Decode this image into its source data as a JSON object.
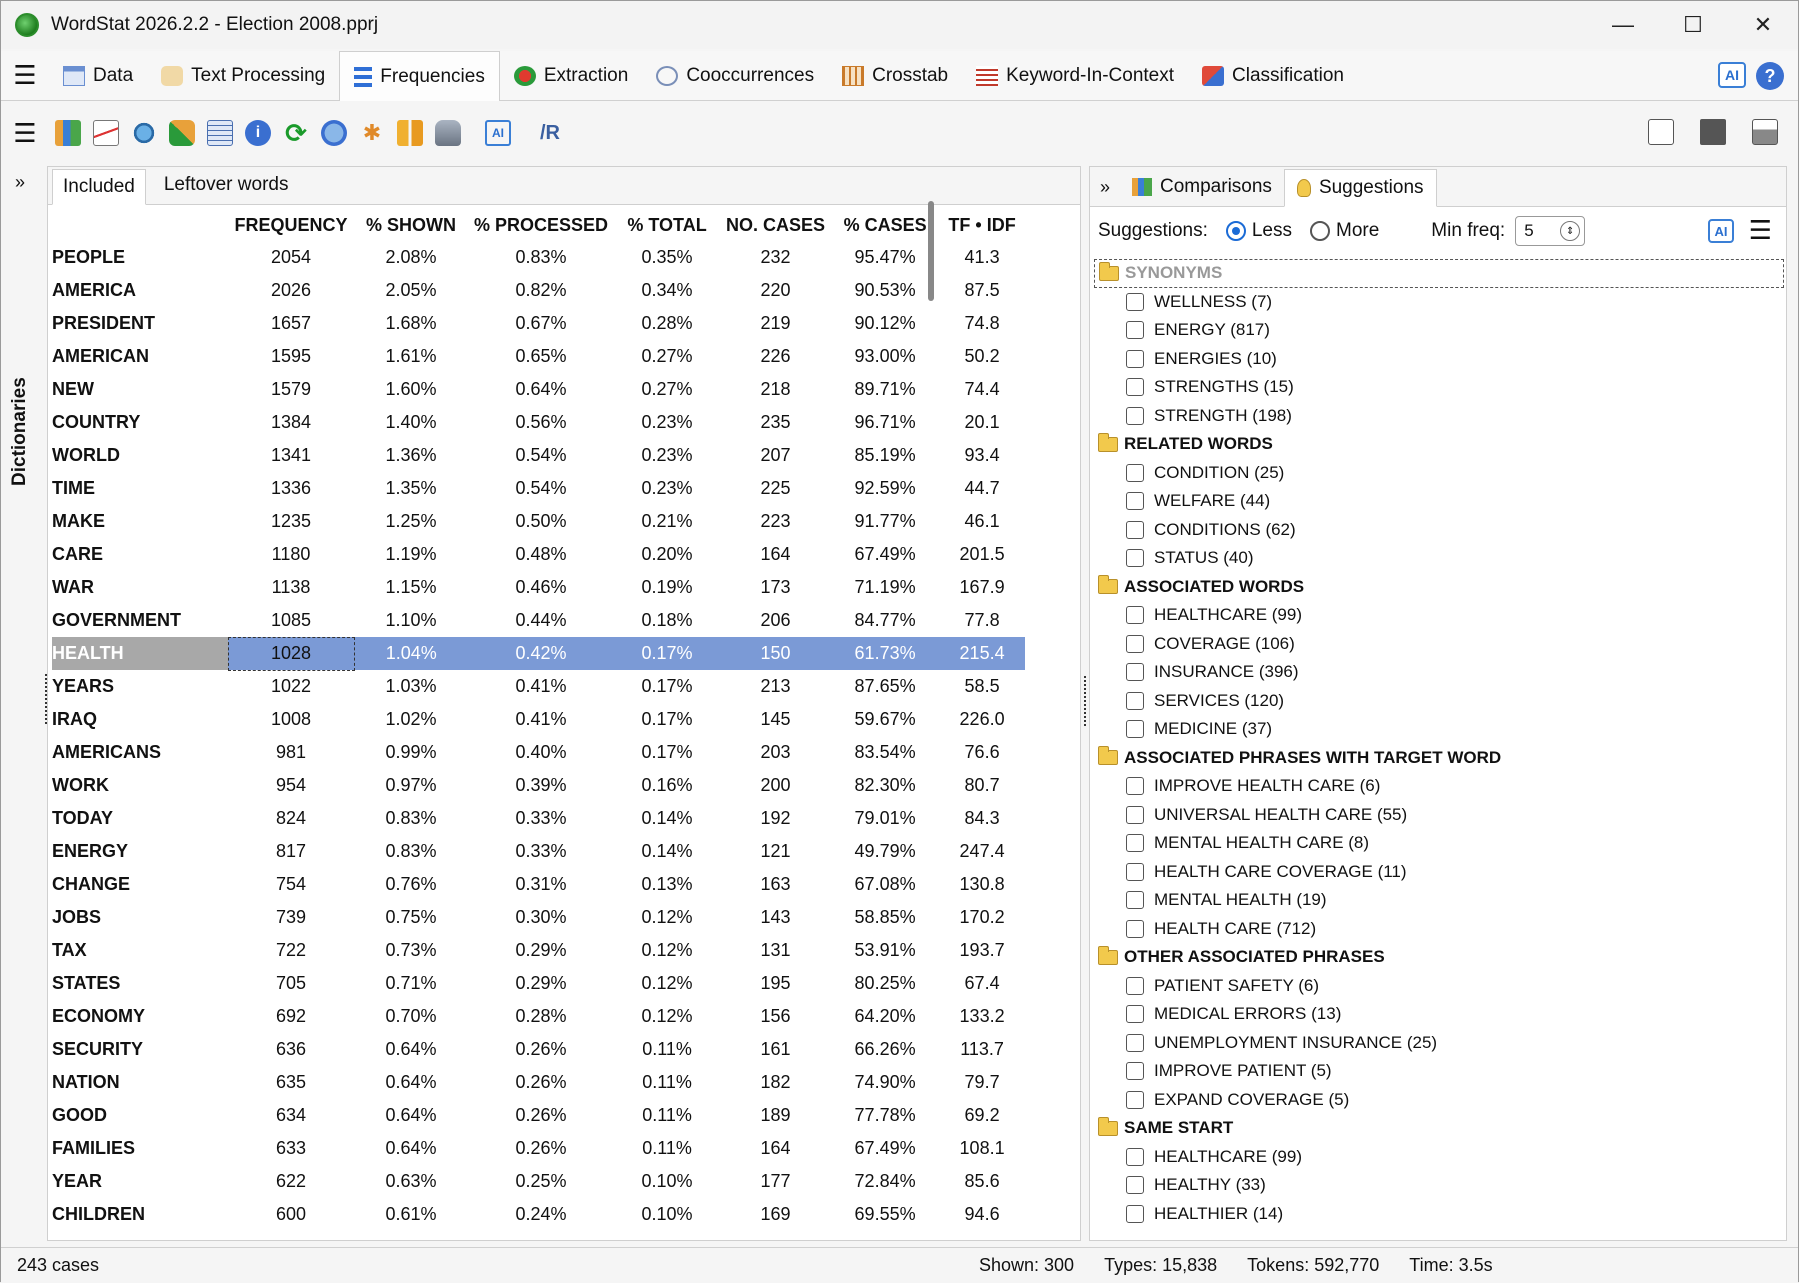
{
  "window": {
    "title": "WordStat 2026.2.2 - Election 2008.pprj"
  },
  "main_tabs": [
    {
      "label": "Data"
    },
    {
      "label": "Text Processing"
    },
    {
      "label": "Frequencies"
    },
    {
      "label": "Extraction"
    },
    {
      "label": "Cooccurrences"
    },
    {
      "label": "Crosstab"
    },
    {
      "label": "Keyword-In-Context"
    },
    {
      "label": "Classification"
    }
  ],
  "ai_label": "AI",
  "help_label": "?",
  "sidebar": {
    "label": "Dictionaries"
  },
  "sub_tabs": {
    "included": "Included",
    "leftover": "Leftover words"
  },
  "table": {
    "headers": [
      "FREQUENCY",
      "% SHOWN",
      "% PROCESSED",
      "% TOTAL",
      "NO. CASES",
      "% CASES",
      "TF • IDF"
    ],
    "rows": [
      [
        "PEOPLE",
        "2054",
        "2.08%",
        "0.83%",
        "0.35%",
        "232",
        "95.47%",
        "41.3"
      ],
      [
        "AMERICA",
        "2026",
        "2.05%",
        "0.82%",
        "0.34%",
        "220",
        "90.53%",
        "87.5"
      ],
      [
        "PRESIDENT",
        "1657",
        "1.68%",
        "0.67%",
        "0.28%",
        "219",
        "90.12%",
        "74.8"
      ],
      [
        "AMERICAN",
        "1595",
        "1.61%",
        "0.65%",
        "0.27%",
        "226",
        "93.00%",
        "50.2"
      ],
      [
        "NEW",
        "1579",
        "1.60%",
        "0.64%",
        "0.27%",
        "218",
        "89.71%",
        "74.4"
      ],
      [
        "COUNTRY",
        "1384",
        "1.40%",
        "0.56%",
        "0.23%",
        "235",
        "96.71%",
        "20.1"
      ],
      [
        "WORLD",
        "1341",
        "1.36%",
        "0.54%",
        "0.23%",
        "207",
        "85.19%",
        "93.4"
      ],
      [
        "TIME",
        "1336",
        "1.35%",
        "0.54%",
        "0.23%",
        "225",
        "92.59%",
        "44.7"
      ],
      [
        "MAKE",
        "1235",
        "1.25%",
        "0.50%",
        "0.21%",
        "223",
        "91.77%",
        "46.1"
      ],
      [
        "CARE",
        "1180",
        "1.19%",
        "0.48%",
        "0.20%",
        "164",
        "67.49%",
        "201.5"
      ],
      [
        "WAR",
        "1138",
        "1.15%",
        "0.46%",
        "0.19%",
        "173",
        "71.19%",
        "167.9"
      ],
      [
        "GOVERNMENT",
        "1085",
        "1.10%",
        "0.44%",
        "0.18%",
        "206",
        "84.77%",
        "77.8"
      ],
      [
        "HEALTH",
        "1028",
        "1.04%",
        "0.42%",
        "0.17%",
        "150",
        "61.73%",
        "215.4"
      ],
      [
        "YEARS",
        "1022",
        "1.03%",
        "0.41%",
        "0.17%",
        "213",
        "87.65%",
        "58.5"
      ],
      [
        "IRAQ",
        "1008",
        "1.02%",
        "0.41%",
        "0.17%",
        "145",
        "59.67%",
        "226.0"
      ],
      [
        "AMERICANS",
        "981",
        "0.99%",
        "0.40%",
        "0.17%",
        "203",
        "83.54%",
        "76.6"
      ],
      [
        "WORK",
        "954",
        "0.97%",
        "0.39%",
        "0.16%",
        "200",
        "82.30%",
        "80.7"
      ],
      [
        "TODAY",
        "824",
        "0.83%",
        "0.33%",
        "0.14%",
        "192",
        "79.01%",
        "84.3"
      ],
      [
        "ENERGY",
        "817",
        "0.83%",
        "0.33%",
        "0.14%",
        "121",
        "49.79%",
        "247.4"
      ],
      [
        "CHANGE",
        "754",
        "0.76%",
        "0.31%",
        "0.13%",
        "163",
        "67.08%",
        "130.8"
      ],
      [
        "JOBS",
        "739",
        "0.75%",
        "0.30%",
        "0.12%",
        "143",
        "58.85%",
        "170.2"
      ],
      [
        "TAX",
        "722",
        "0.73%",
        "0.29%",
        "0.12%",
        "131",
        "53.91%",
        "193.7"
      ],
      [
        "STATES",
        "705",
        "0.71%",
        "0.29%",
        "0.12%",
        "195",
        "80.25%",
        "67.4"
      ],
      [
        "ECONOMY",
        "692",
        "0.70%",
        "0.28%",
        "0.12%",
        "156",
        "64.20%",
        "133.2"
      ],
      [
        "SECURITY",
        "636",
        "0.64%",
        "0.26%",
        "0.11%",
        "161",
        "66.26%",
        "113.7"
      ],
      [
        "NATION",
        "635",
        "0.64%",
        "0.26%",
        "0.11%",
        "182",
        "74.90%",
        "79.7"
      ],
      [
        "GOOD",
        "634",
        "0.64%",
        "0.26%",
        "0.11%",
        "189",
        "77.78%",
        "69.2"
      ],
      [
        "FAMILIES",
        "633",
        "0.64%",
        "0.26%",
        "0.11%",
        "164",
        "67.49%",
        "108.1"
      ],
      [
        "YEAR",
        "622",
        "0.63%",
        "0.25%",
        "0.10%",
        "177",
        "72.84%",
        "85.6"
      ],
      [
        "CHILDREN",
        "600",
        "0.61%",
        "0.24%",
        "0.10%",
        "169",
        "69.55%",
        "94.6"
      ]
    ],
    "selected_word": "HEALTH"
  },
  "right_tabs": {
    "comparisons": "Comparisons",
    "suggestions": "Suggestions"
  },
  "suggestions_bar": {
    "label": "Suggestions:",
    "less": "Less",
    "more": "More",
    "selected": "Less",
    "minfreq_label": "Min freq:",
    "minfreq_value": "5"
  },
  "groups": [
    {
      "title": "SYNONYMS",
      "items": [
        "WELLNESS (7)",
        "ENERGY (817)",
        "ENERGIES (10)",
        "STRENGTHS (15)",
        "STRENGTH (198)"
      ]
    },
    {
      "title": "RELATED WORDS",
      "items": [
        "CONDITION (25)",
        "WELFARE (44)",
        "CONDITIONS (62)",
        "STATUS (40)"
      ]
    },
    {
      "title": "ASSOCIATED WORDS",
      "items": [
        "HEALTHCARE (99)",
        "COVERAGE (106)",
        "INSURANCE (396)",
        "SERVICES (120)",
        "MEDICINE (37)"
      ]
    },
    {
      "title": "ASSOCIATED PHRASES WITH TARGET WORD",
      "items": [
        "IMPROVE HEALTH CARE (6)",
        "UNIVERSAL HEALTH CARE (55)",
        "MENTAL HEALTH CARE (8)",
        "HEALTH CARE COVERAGE (11)",
        "MENTAL HEALTH (19)",
        "HEALTH CARE (712)"
      ]
    },
    {
      "title": "OTHER ASSOCIATED PHRASES",
      "items": [
        "PATIENT SAFETY (6)",
        "MEDICAL ERRORS (13)",
        "UNEMPLOYMENT INSURANCE (25)",
        "IMPROVE PATIENT (5)",
        "EXPAND COVERAGE (5)"
      ]
    },
    {
      "title": "SAME START",
      "items": [
        "HEALTHCARE (99)",
        "HEALTHY (33)",
        "HEALTHIER (14)"
      ]
    }
  ],
  "status": {
    "cases": "243 cases",
    "shown": "Shown: 300",
    "types": "Types: 15,838",
    "tokens": "Tokens: 592,770",
    "time": "Time: 3.5s"
  }
}
